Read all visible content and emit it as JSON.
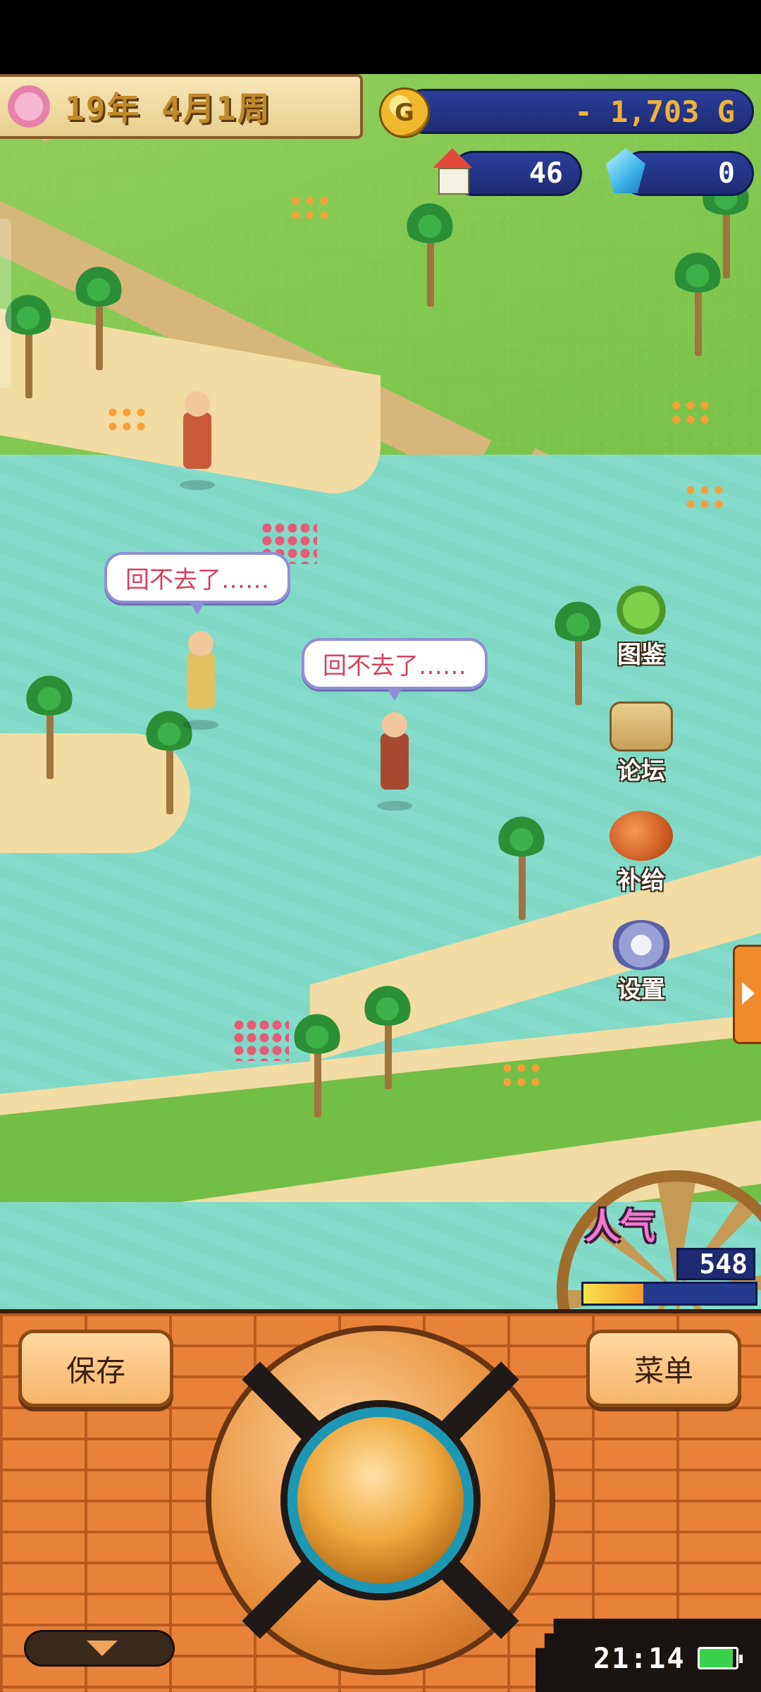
{
  "hud": {
    "date": "19年 4月1周",
    "money": "- 1,703 G",
    "coin_symbol": "G",
    "population": "46",
    "crystals": "0"
  },
  "speech": {
    "bubble1": "回不去了……",
    "bubble2": "回不去了……"
  },
  "side_menu": {
    "encyclopedia": "图鉴",
    "forum": "论坛",
    "supply": "补给",
    "settings": "设置"
  },
  "popularity": {
    "label": "人气",
    "value": "548",
    "bar_fraction": 0.35
  },
  "controls": {
    "save": "保存",
    "menu": "菜单"
  },
  "status": {
    "clock": "21:14",
    "battery_fraction": 0.9
  },
  "colors": {
    "accent_orange": "#e8823a",
    "hud_blue": "#1d2b73",
    "speech_text": "#d6425c"
  },
  "icons": [
    "flower-icon",
    "coin-icon",
    "house-icon",
    "crystal-icon",
    "monster-book-icon",
    "quill-scroll-icon",
    "meat-icon",
    "gear-icon"
  ]
}
